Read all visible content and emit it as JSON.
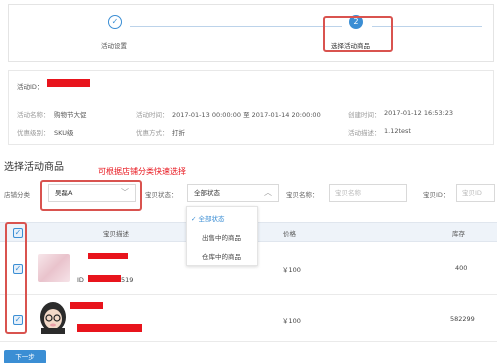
{
  "steps": [
    {
      "icon": "✓",
      "label": "活动设置"
    },
    {
      "icon": "2",
      "label": "选择活动商品"
    }
  ],
  "activity": {
    "id_label": "活动ID：",
    "name_label": "活动名称：",
    "name_value": "购物节大促",
    "time_label": "活动时间：",
    "time_value": "2017-01-13 00:00:00 至 2017-01-14 20:00:00",
    "created_label": "创建时间：",
    "created_value": "2017-01-12 16:53:23",
    "level_label": "优惠级别：",
    "level_value": "SKU级",
    "mode_label": "优惠方式：",
    "mode_value": "打折",
    "desc_label": "活动描述：",
    "desc_value": "1.12test"
  },
  "section": {
    "title": "选择活动商品",
    "hint": "可根据店铺分类快速选择"
  },
  "filters": {
    "shop_category_label": "店铺分类",
    "shop_category_value": "吴磊A",
    "status_label": "宝贝状态：",
    "status_value": "全部状态",
    "name_label": "宝贝名称：",
    "name_placeholder": "宝贝名称",
    "id_label": "宝贝ID：",
    "id_placeholder": "宝贝ID"
  },
  "status_options": [
    {
      "label": "全部状态",
      "selected": true
    },
    {
      "label": "出售中的商品",
      "selected": false
    },
    {
      "label": "仓库中的商品",
      "selected": false
    }
  ],
  "table": {
    "headers": {
      "desc": "宝贝描述",
      "price": "价格",
      "stock": "库存"
    },
    "rows": [
      {
        "id_prefix": "ID",
        "id_suffix": "519",
        "price": "￥100",
        "stock": "400"
      },
      {
        "price": "￥100",
        "stock": "582299"
      }
    ]
  },
  "checkbox_mark": "✓",
  "next_button": "下一步",
  "colors": {
    "accent": "#3b8ed4",
    "highlight": "#d9534f",
    "redaction": "#e8141c"
  }
}
